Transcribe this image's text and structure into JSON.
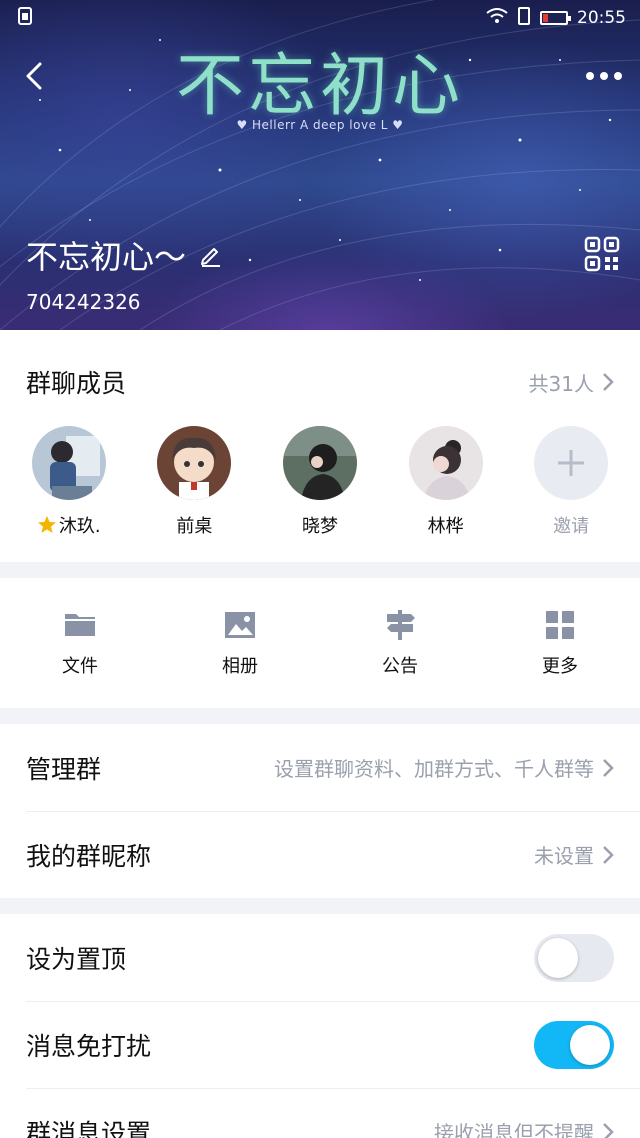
{
  "status_bar": {
    "time": "20:55"
  },
  "header": {
    "banner_title": "不忘初心",
    "banner_subtitle": "♥ Hellerr A deep love L ♥",
    "group_name": "不忘初心～",
    "group_id": "704242326"
  },
  "members": {
    "title": "群聊成员",
    "count_label": "共31人",
    "list": [
      {
        "name": "沐玖.",
        "starred": true
      },
      {
        "name": "前桌"
      },
      {
        "name": "晓梦"
      },
      {
        "name": "林桦"
      }
    ],
    "invite_label": "邀请"
  },
  "tools": [
    {
      "label": "文件",
      "icon": "folder-icon"
    },
    {
      "label": "相册",
      "icon": "image-icon"
    },
    {
      "label": "公告",
      "icon": "signpost-icon"
    },
    {
      "label": "更多",
      "icon": "grid-icon"
    }
  ],
  "settings": {
    "manage": {
      "label": "管理群",
      "value": "设置群聊资料、加群方式、千人群等"
    },
    "nickname": {
      "label": "我的群昵称",
      "value": "未设置"
    },
    "pin": {
      "label": "设为置顶",
      "on": false
    },
    "mute": {
      "label": "消息免打扰",
      "on": true
    },
    "msg": {
      "label": "群消息设置",
      "value": "接收消息但不提醒"
    }
  },
  "colors": {
    "accent": "#12b7f5",
    "muted": "#9aa0ad",
    "icon": "#8a93a6"
  }
}
